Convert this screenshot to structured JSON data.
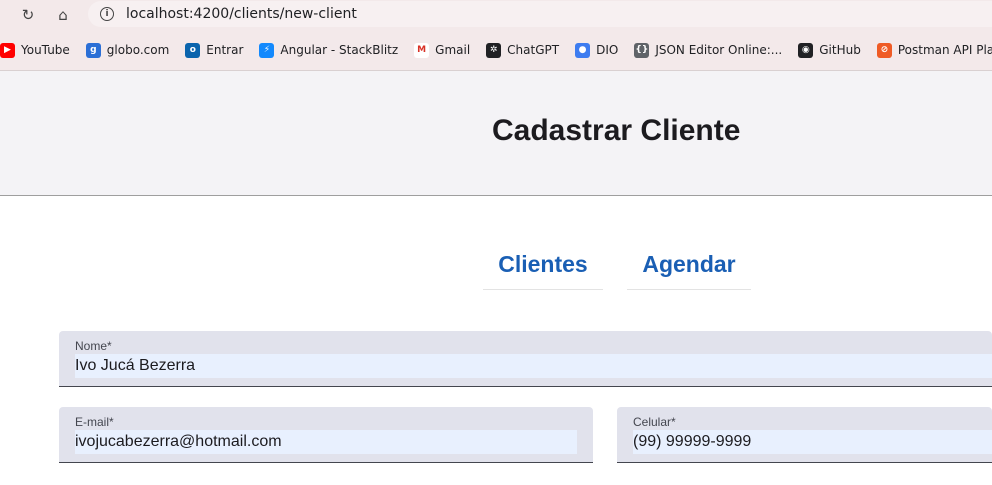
{
  "browser": {
    "url": "localhost:4200/clients/new-client",
    "bookmarks": [
      {
        "label": "YouTube",
        "icon": "youtube-icon",
        "color": "#ff0000",
        "glyph": "▶"
      },
      {
        "label": "globo.com",
        "icon": "globo-icon",
        "color": "#2b6fd6",
        "glyph": "g"
      },
      {
        "label": "Entrar",
        "icon": "outlook-icon",
        "color": "#0a64ad",
        "glyph": "o"
      },
      {
        "label": "Angular - StackBlitz",
        "icon": "stackblitz-icon",
        "color": "#1389fd",
        "glyph": "⚡"
      },
      {
        "label": "Gmail",
        "icon": "gmail-icon",
        "color": "#ffffff",
        "glyph": "M"
      },
      {
        "label": "ChatGPT",
        "icon": "chatgpt-icon",
        "color": "#202124",
        "glyph": "✲"
      },
      {
        "label": "DIO",
        "icon": "dio-icon",
        "color": "#3d7cf0",
        "glyph": "●"
      },
      {
        "label": "JSON Editor Online:...",
        "icon": "json-editor-icon",
        "color": "#5f6368",
        "glyph": "{}"
      },
      {
        "label": "GitHub",
        "icon": "github-icon",
        "color": "#202124",
        "glyph": "◉"
      },
      {
        "label": "Postman API Platform",
        "icon": "postman-icon",
        "color": "#ef5b25",
        "glyph": "⊘"
      }
    ]
  },
  "page": {
    "title": "Cadastrar Cliente",
    "tabs": [
      {
        "label": "Clientes"
      },
      {
        "label": "Agendar"
      }
    ]
  },
  "form": {
    "name": {
      "label": "Nome*",
      "value": "Ivo Jucá Bezerra"
    },
    "email": {
      "label": "E-mail*",
      "value": "ivojucabezerra@hotmail.com"
    },
    "phone": {
      "label": "Celular*",
      "value": "(99) 99999-9999"
    }
  }
}
